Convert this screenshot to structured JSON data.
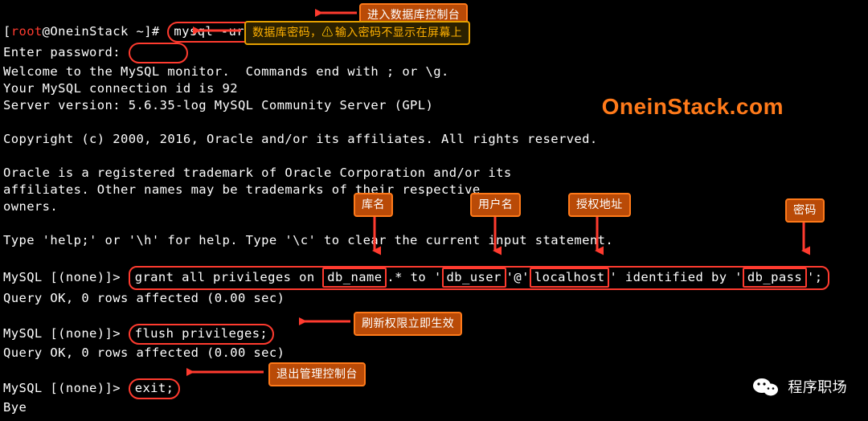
{
  "prompt": {
    "user": "root",
    "atHost": "@OneinStack",
    "cwd": " ~",
    "sep": "]# "
  },
  "cmds": {
    "mysql": "mysql -uroot -p",
    "enter_password": "Enter password:",
    "grant_prefix": "grant all privileges on ",
    "db_name": "db_name",
    "grant_mid1": ".* to '",
    "db_user": "db_user",
    "grant_mid2": "'@'",
    "db_host": "localhost",
    "grant_mid3": "' identified by '",
    "db_pass": "db_pass",
    "grant_end": "';",
    "flush": "flush privileges;",
    "exit": "exit;"
  },
  "lines": {
    "welcome": "Welcome to the MySQL monitor.  Commands end with ; or \\g.",
    "conn": "Your MySQL connection id is 92",
    "ver": "Server version: 5.6.35-log MySQL Community Server (GPL)",
    "copyright": "Copyright (c) 2000, 2016, Oracle and/or its affiliates. All rights reserved.",
    "oracle1": "Oracle is a registered trademark of Oracle Corporation and/or its",
    "oracle2": "affiliates. Other names may be trademarks of their respective",
    "oracle3": "owners.",
    "help": "Type 'help;' or '\\h' for help. Type '\\c' to clear the current input statement.",
    "qok": "Query OK, 0 rows affected (0.00 sec)",
    "bye": "Bye",
    "mysqlprompt": "MySQL [(none)]> "
  },
  "annotations": {
    "enter_console": "进入数据库控制台",
    "db_password": "数据库密码，",
    "pwd_hidden": "输入密码不显示在屏幕上",
    "dbname": "库名",
    "username": "用户名",
    "authaddr": "授权地址",
    "password": "密码",
    "flush_now": "刷新权限立即生效",
    "exit_console": "退出管理控制台"
  },
  "watermark": "OneinStack.com",
  "wechat": "程序职场"
}
